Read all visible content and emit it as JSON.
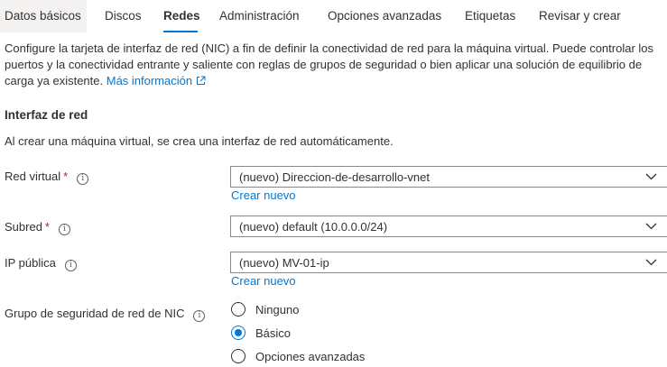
{
  "tabs": [
    {
      "label": "Datos básicos",
      "active": false
    },
    {
      "label": "Discos",
      "active": false
    },
    {
      "label": "Redes",
      "active": true
    },
    {
      "label": "Administración",
      "active": false
    },
    {
      "label": "Opciones avanzadas",
      "active": false
    },
    {
      "label": "Etiquetas",
      "active": false
    },
    {
      "label": "Revisar y crear",
      "active": false
    }
  ],
  "description": {
    "text": "Configure la tarjeta de interfaz de red (NIC) a fin de definir la conectividad de red para la máquina virtual. Puede controlar los puertos y la conectividad entrante y saliente con reglas de grupos de seguridad o bien aplicar una solución de equilibrio de carga ya existente. ",
    "link": "Más información"
  },
  "network_interface": {
    "title": "Interfaz de red",
    "info": "Al crear una máquina virtual, se crea una interfaz de red automáticamente."
  },
  "fields": {
    "vnet": {
      "label": "Red virtual",
      "required": "*",
      "value": "(nuevo) Direccion-de-desarrollo-vnet",
      "create_link": "Crear nuevo"
    },
    "subnet": {
      "label": "Subred",
      "required": "*",
      "value": "(nuevo) default (10.0.0.0/24)"
    },
    "public_ip": {
      "label": "IP pública",
      "value": "(nuevo) MV-01-ip",
      "create_link": "Crear nuevo"
    },
    "nsg": {
      "label": "Grupo de seguridad de red de NIC",
      "options": [
        {
          "label": "Ninguno",
          "checked": false
        },
        {
          "label": "Básico",
          "checked": true
        },
        {
          "label": "Opciones avanzadas",
          "checked": false
        }
      ]
    }
  },
  "icons": {
    "info": "info-icon",
    "chevron": "chevron-down-icon",
    "external": "external-link-icon"
  },
  "colors": {
    "accent": "#0078d4",
    "required": "#a4262c",
    "text": "#323130",
    "tab_hover_bg": "#f3f2f1"
  }
}
